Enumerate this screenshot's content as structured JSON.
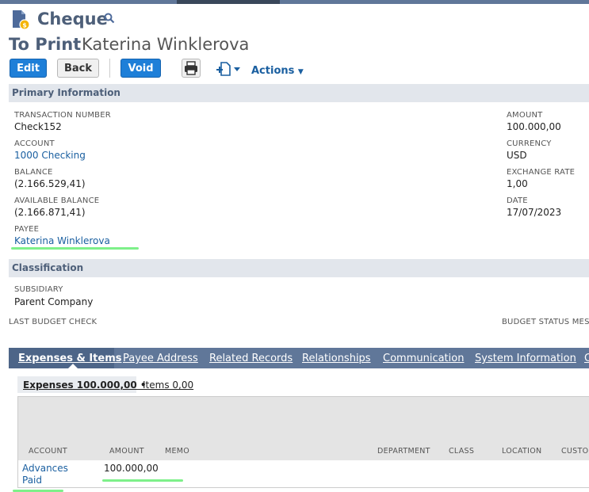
{
  "colors": {
    "accent": "#607799",
    "header_text": "#4d5f79",
    "link": "#1a5fa0",
    "button_blue": "#1e7fd8",
    "highlight": "#7ef08a"
  },
  "page": {
    "title": "Cheque",
    "status": "To Print",
    "record_name": "Katerina Winklerova"
  },
  "toolbar": {
    "edit": "Edit",
    "back": "Back",
    "void": "Void",
    "actions": "Actions"
  },
  "primary": {
    "header": "Primary Information",
    "left": [
      {
        "label": "TRANSACTION NUMBER",
        "value": "Check152",
        "link": false
      },
      {
        "label": "ACCOUNT",
        "value": "1000 Checking",
        "link": true
      },
      {
        "label": "BALANCE",
        "value": "(2.166.529,41)",
        "link": false
      },
      {
        "label": "AVAILABLE BALANCE",
        "value": "(2.166.871,41)",
        "link": false
      },
      {
        "label": "PAYEE",
        "value": "Katerina Winklerova",
        "link": true
      }
    ],
    "right": [
      {
        "label": "AMOUNT",
        "value": "100.000,00"
      },
      {
        "label": "CURRENCY",
        "value": "USD"
      },
      {
        "label": "EXCHANGE RATE",
        "value": "1,00"
      },
      {
        "label": "DATE",
        "value": "17/07/2023"
      }
    ]
  },
  "classification": {
    "header": "Classification",
    "subsidiary_label": "SUBSIDIARY",
    "subsidiary_value": "Parent Company",
    "last_budget_check": "LAST BUDGET CHECK",
    "budget_status": "BUDGET STATUS MESS"
  },
  "tabs": [
    "Expenses & Items",
    "Payee Address",
    "Related Records",
    "Relationships",
    "Communication",
    "System Information",
    "C"
  ],
  "subtabs": {
    "expenses": "Expenses 100.000,00 •",
    "items": "Items 0,00"
  },
  "grid": {
    "columns": [
      "ACCOUNT",
      "AMOUNT",
      "MEMO",
      "DEPARTMENT",
      "CLASS",
      "LOCATION",
      "CUSTOM"
    ],
    "rows": [
      {
        "account": "Advances Paid",
        "amount": "100.000,00"
      }
    ]
  }
}
